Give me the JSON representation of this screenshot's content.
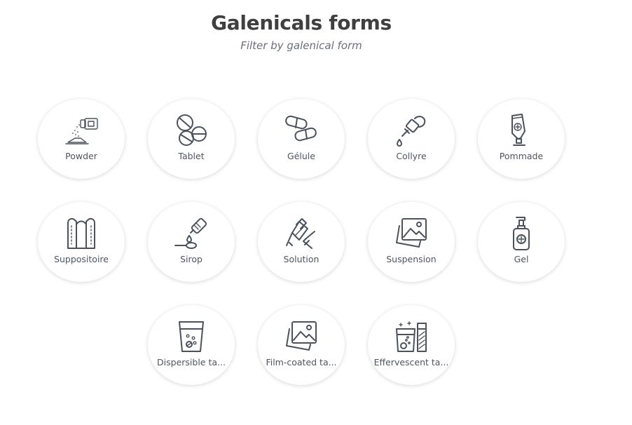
{
  "header": {
    "title": "Galenicals forms",
    "subtitle": "Filter by galenical form"
  },
  "forms": [
    {
      "label": "Powder",
      "icon": "powder-icon"
    },
    {
      "label": "Tablet",
      "icon": "tablet-icon"
    },
    {
      "label": "Gélule",
      "icon": "capsule-icon"
    },
    {
      "label": "Collyre",
      "icon": "eye-dropper-icon"
    },
    {
      "label": "Pommade",
      "icon": "ointment-tube-icon"
    },
    {
      "label": "Suppositoire",
      "icon": "suppository-icon"
    },
    {
      "label": "Sirop",
      "icon": "syrup-spoon-icon"
    },
    {
      "label": "Solution",
      "icon": "solution-vial-icon"
    },
    {
      "label": "Suspension",
      "icon": "image-icon"
    },
    {
      "label": "Gel",
      "icon": "pump-bottle-icon"
    },
    {
      "label": "Dispersible ta...",
      "icon": "dispersible-glass-icon"
    },
    {
      "label": "Film-coated ta...",
      "icon": "image-icon"
    },
    {
      "label": "Effervescent ta...",
      "icon": "effervescent-tablet-icon"
    }
  ],
  "colors": {
    "icon_stroke": "#4b525d",
    "title": "#3f3f3f",
    "subtitle": "#6a6f7a"
  }
}
